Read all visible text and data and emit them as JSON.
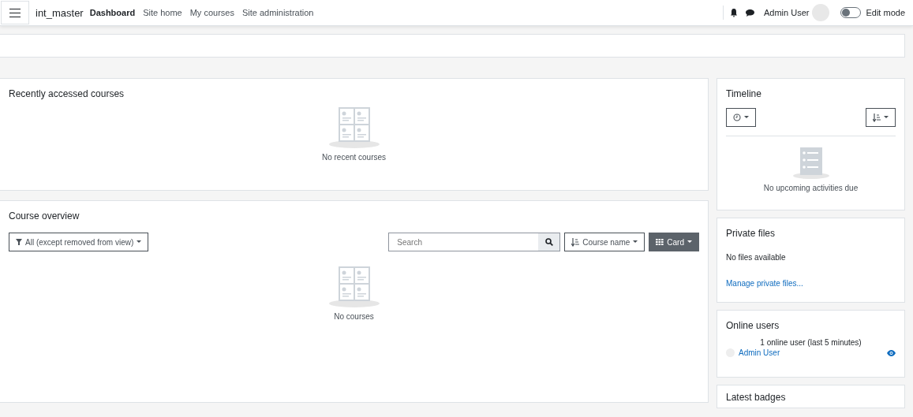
{
  "navbar": {
    "site_name": "int_master",
    "links": [
      {
        "label": "Dashboard",
        "selected": true
      },
      {
        "label": "Site home",
        "selected": false
      },
      {
        "label": "My courses",
        "selected": false
      },
      {
        "label": "Site administration",
        "selected": false
      }
    ],
    "user_name": "Admin User",
    "edit_mode": {
      "label": "Edit mode",
      "on": false
    }
  },
  "recent_courses": {
    "title": "Recently accessed courses",
    "empty_text": "No recent courses"
  },
  "course_overview": {
    "title": "Course overview",
    "filter": "All (except removed from view)",
    "search": {
      "placeholder": "Search"
    },
    "sort": "Course name",
    "view": "Card",
    "empty_text": "No courses"
  },
  "timeline": {
    "title": "Timeline",
    "empty_text": "No upcoming activities due"
  },
  "private_files": {
    "title": "Private files",
    "text": "No files available",
    "link": "Manage private files..."
  },
  "online_users": {
    "title": "Online users",
    "summary": "1 online user (last 5 minutes)",
    "users": [
      {
        "name": "Admin User"
      }
    ]
  },
  "latest_badges": {
    "title": "Latest badges"
  }
}
